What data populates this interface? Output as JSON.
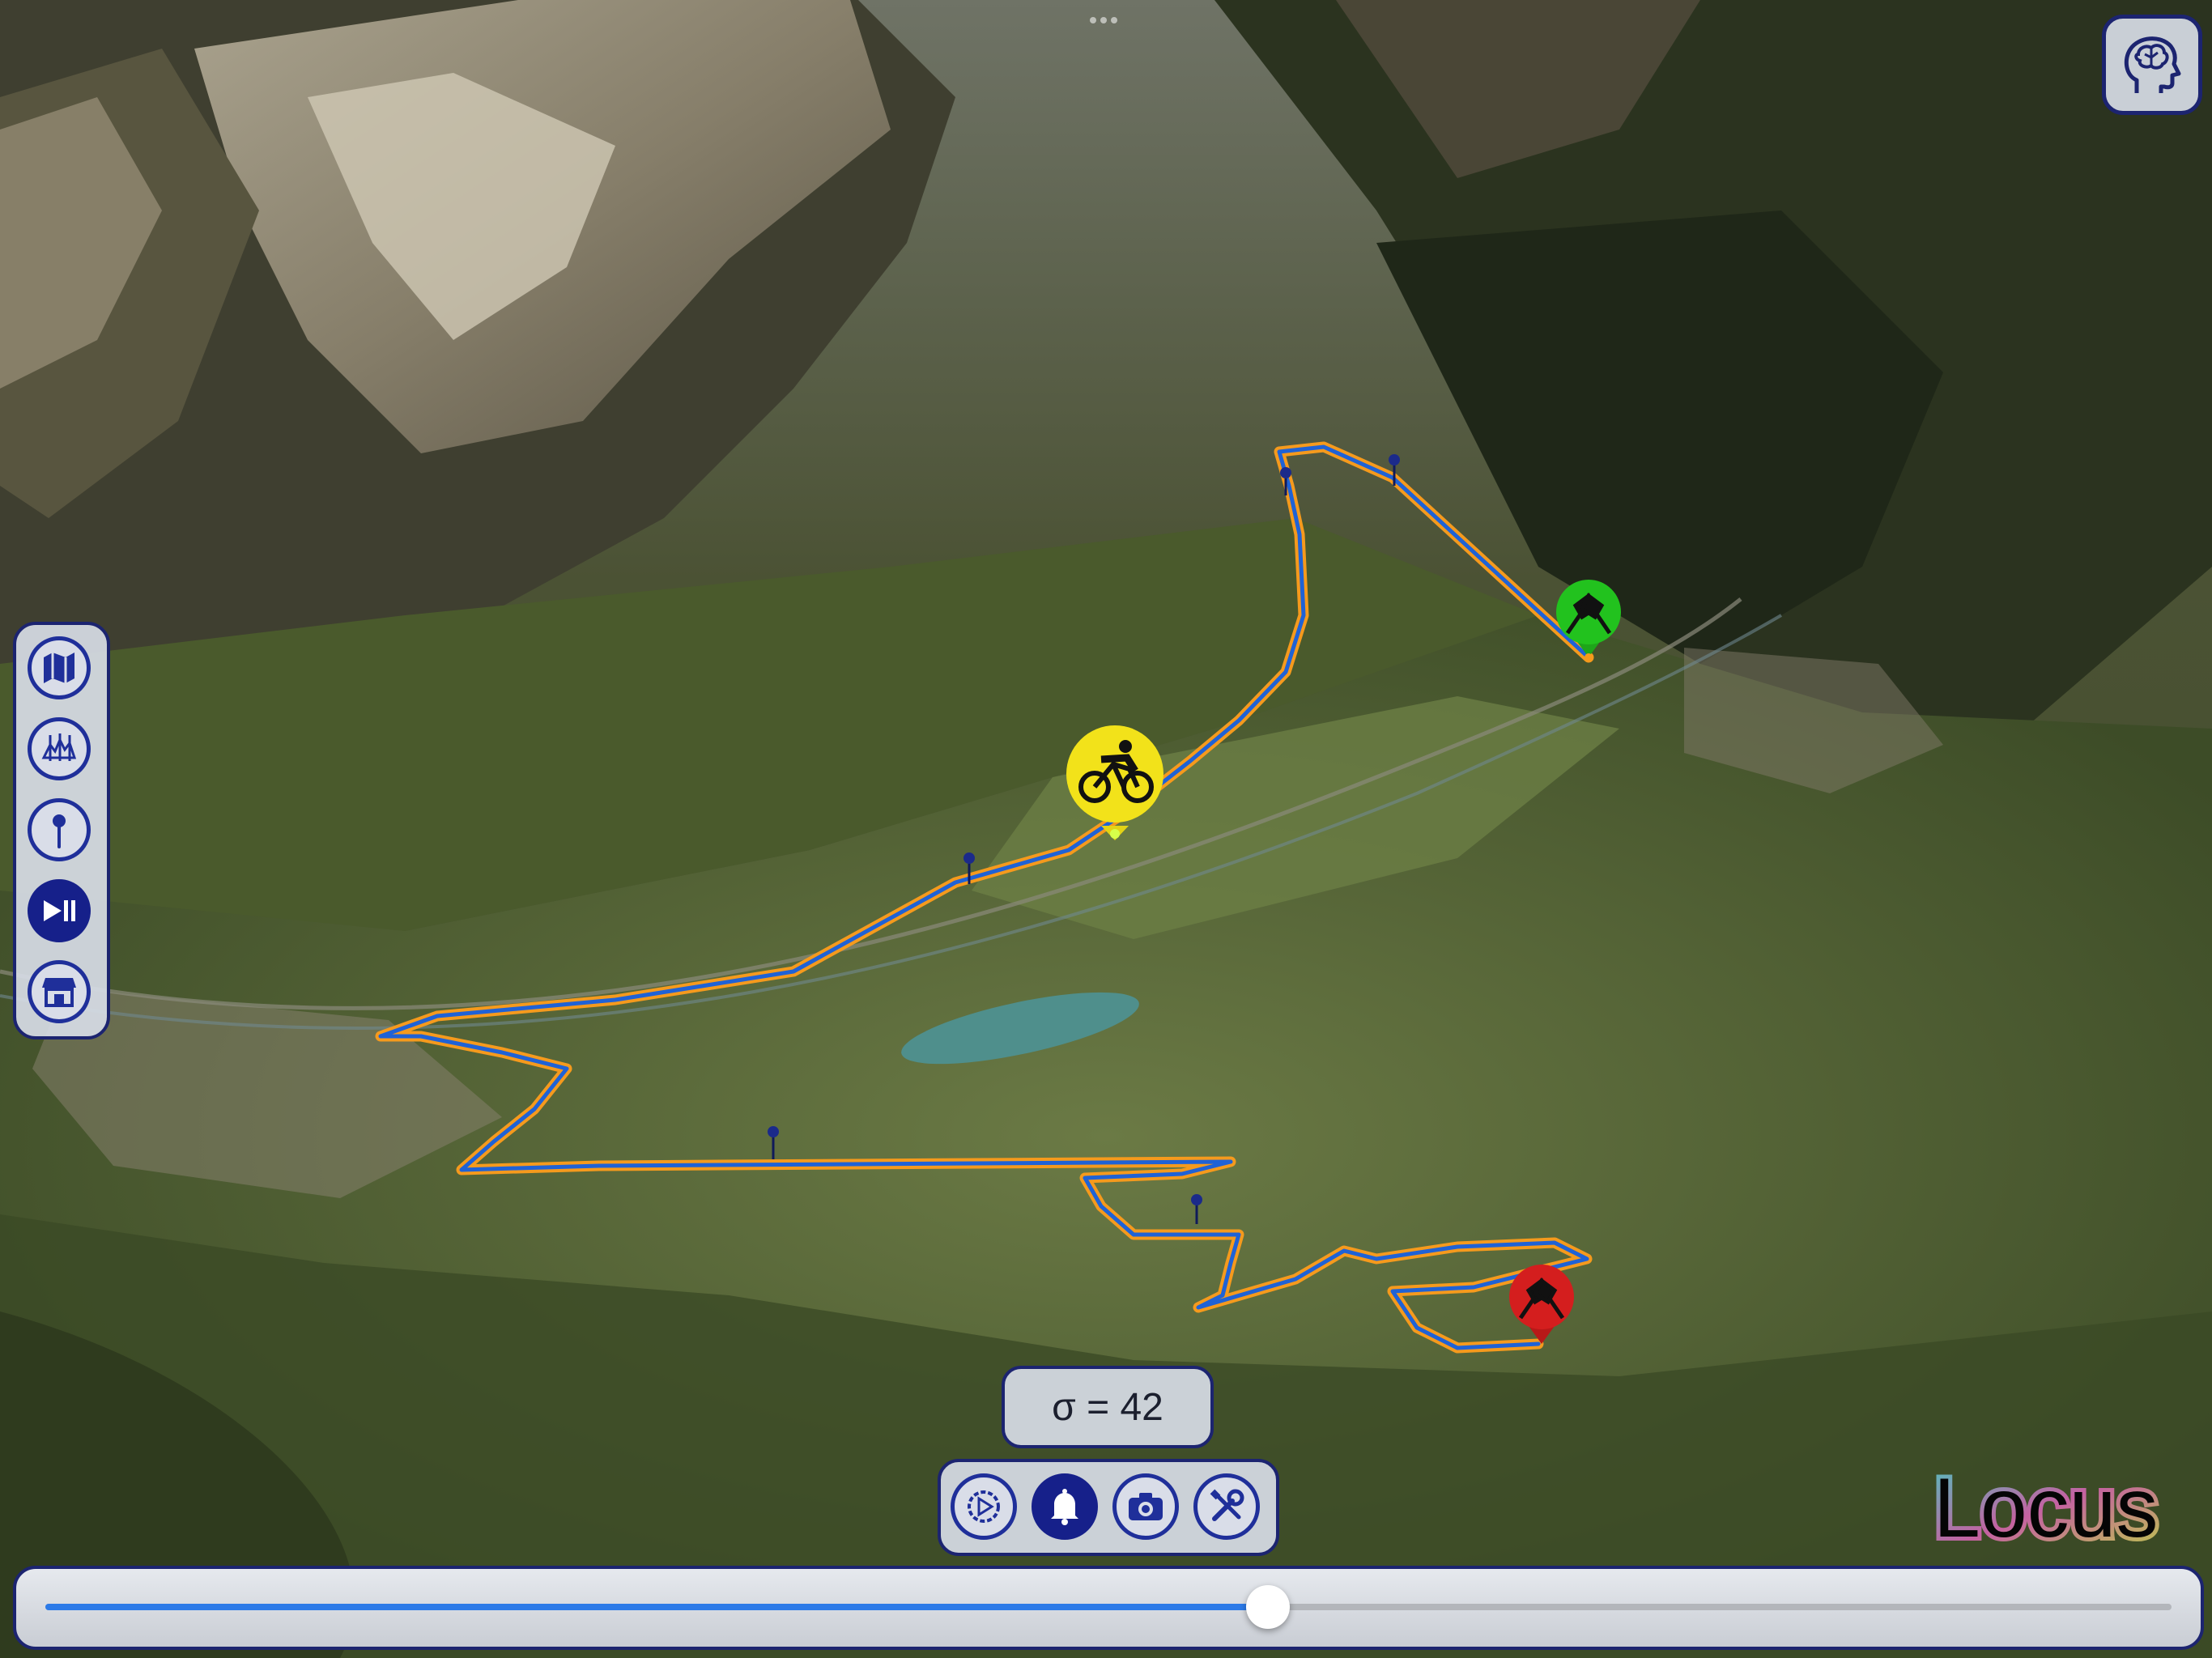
{
  "app": {
    "name": "Locus"
  },
  "status": {
    "sigma_text": "σ = 42"
  },
  "playback": {
    "progress": 0.575
  },
  "sidebar": {
    "items": [
      {
        "name": "map-icon",
        "active": false
      },
      {
        "name": "elevation-profile-icon",
        "active": false
      },
      {
        "name": "pin-icon",
        "active": false
      },
      {
        "name": "play-pause-icon",
        "active": true
      },
      {
        "name": "store-icon",
        "active": false
      }
    ]
  },
  "toolbar": {
    "items": [
      {
        "name": "settings-play-icon",
        "active": false
      },
      {
        "name": "bell-icon",
        "active": true
      },
      {
        "name": "camera-icon",
        "active": false
      },
      {
        "name": "tools-icon",
        "active": false
      }
    ]
  },
  "map": {
    "markers": [
      {
        "name": "cyclist-marker",
        "color": "#f2e21a",
        "icon": "cyclist-icon"
      },
      {
        "name": "start-flag-marker",
        "color": "#22c21e",
        "icon": "checkered-flags-icon"
      },
      {
        "name": "finish-flag-marker",
        "color": "#d41e1e",
        "icon": "checkered-flags-icon"
      }
    ],
    "route_colors": {
      "outline": "#f59a1d",
      "line": "#1f62d6"
    }
  },
  "colors": {
    "accent": "#1c2470",
    "active_button": "#16208a",
    "slider_fill": "#2c7ae8"
  }
}
